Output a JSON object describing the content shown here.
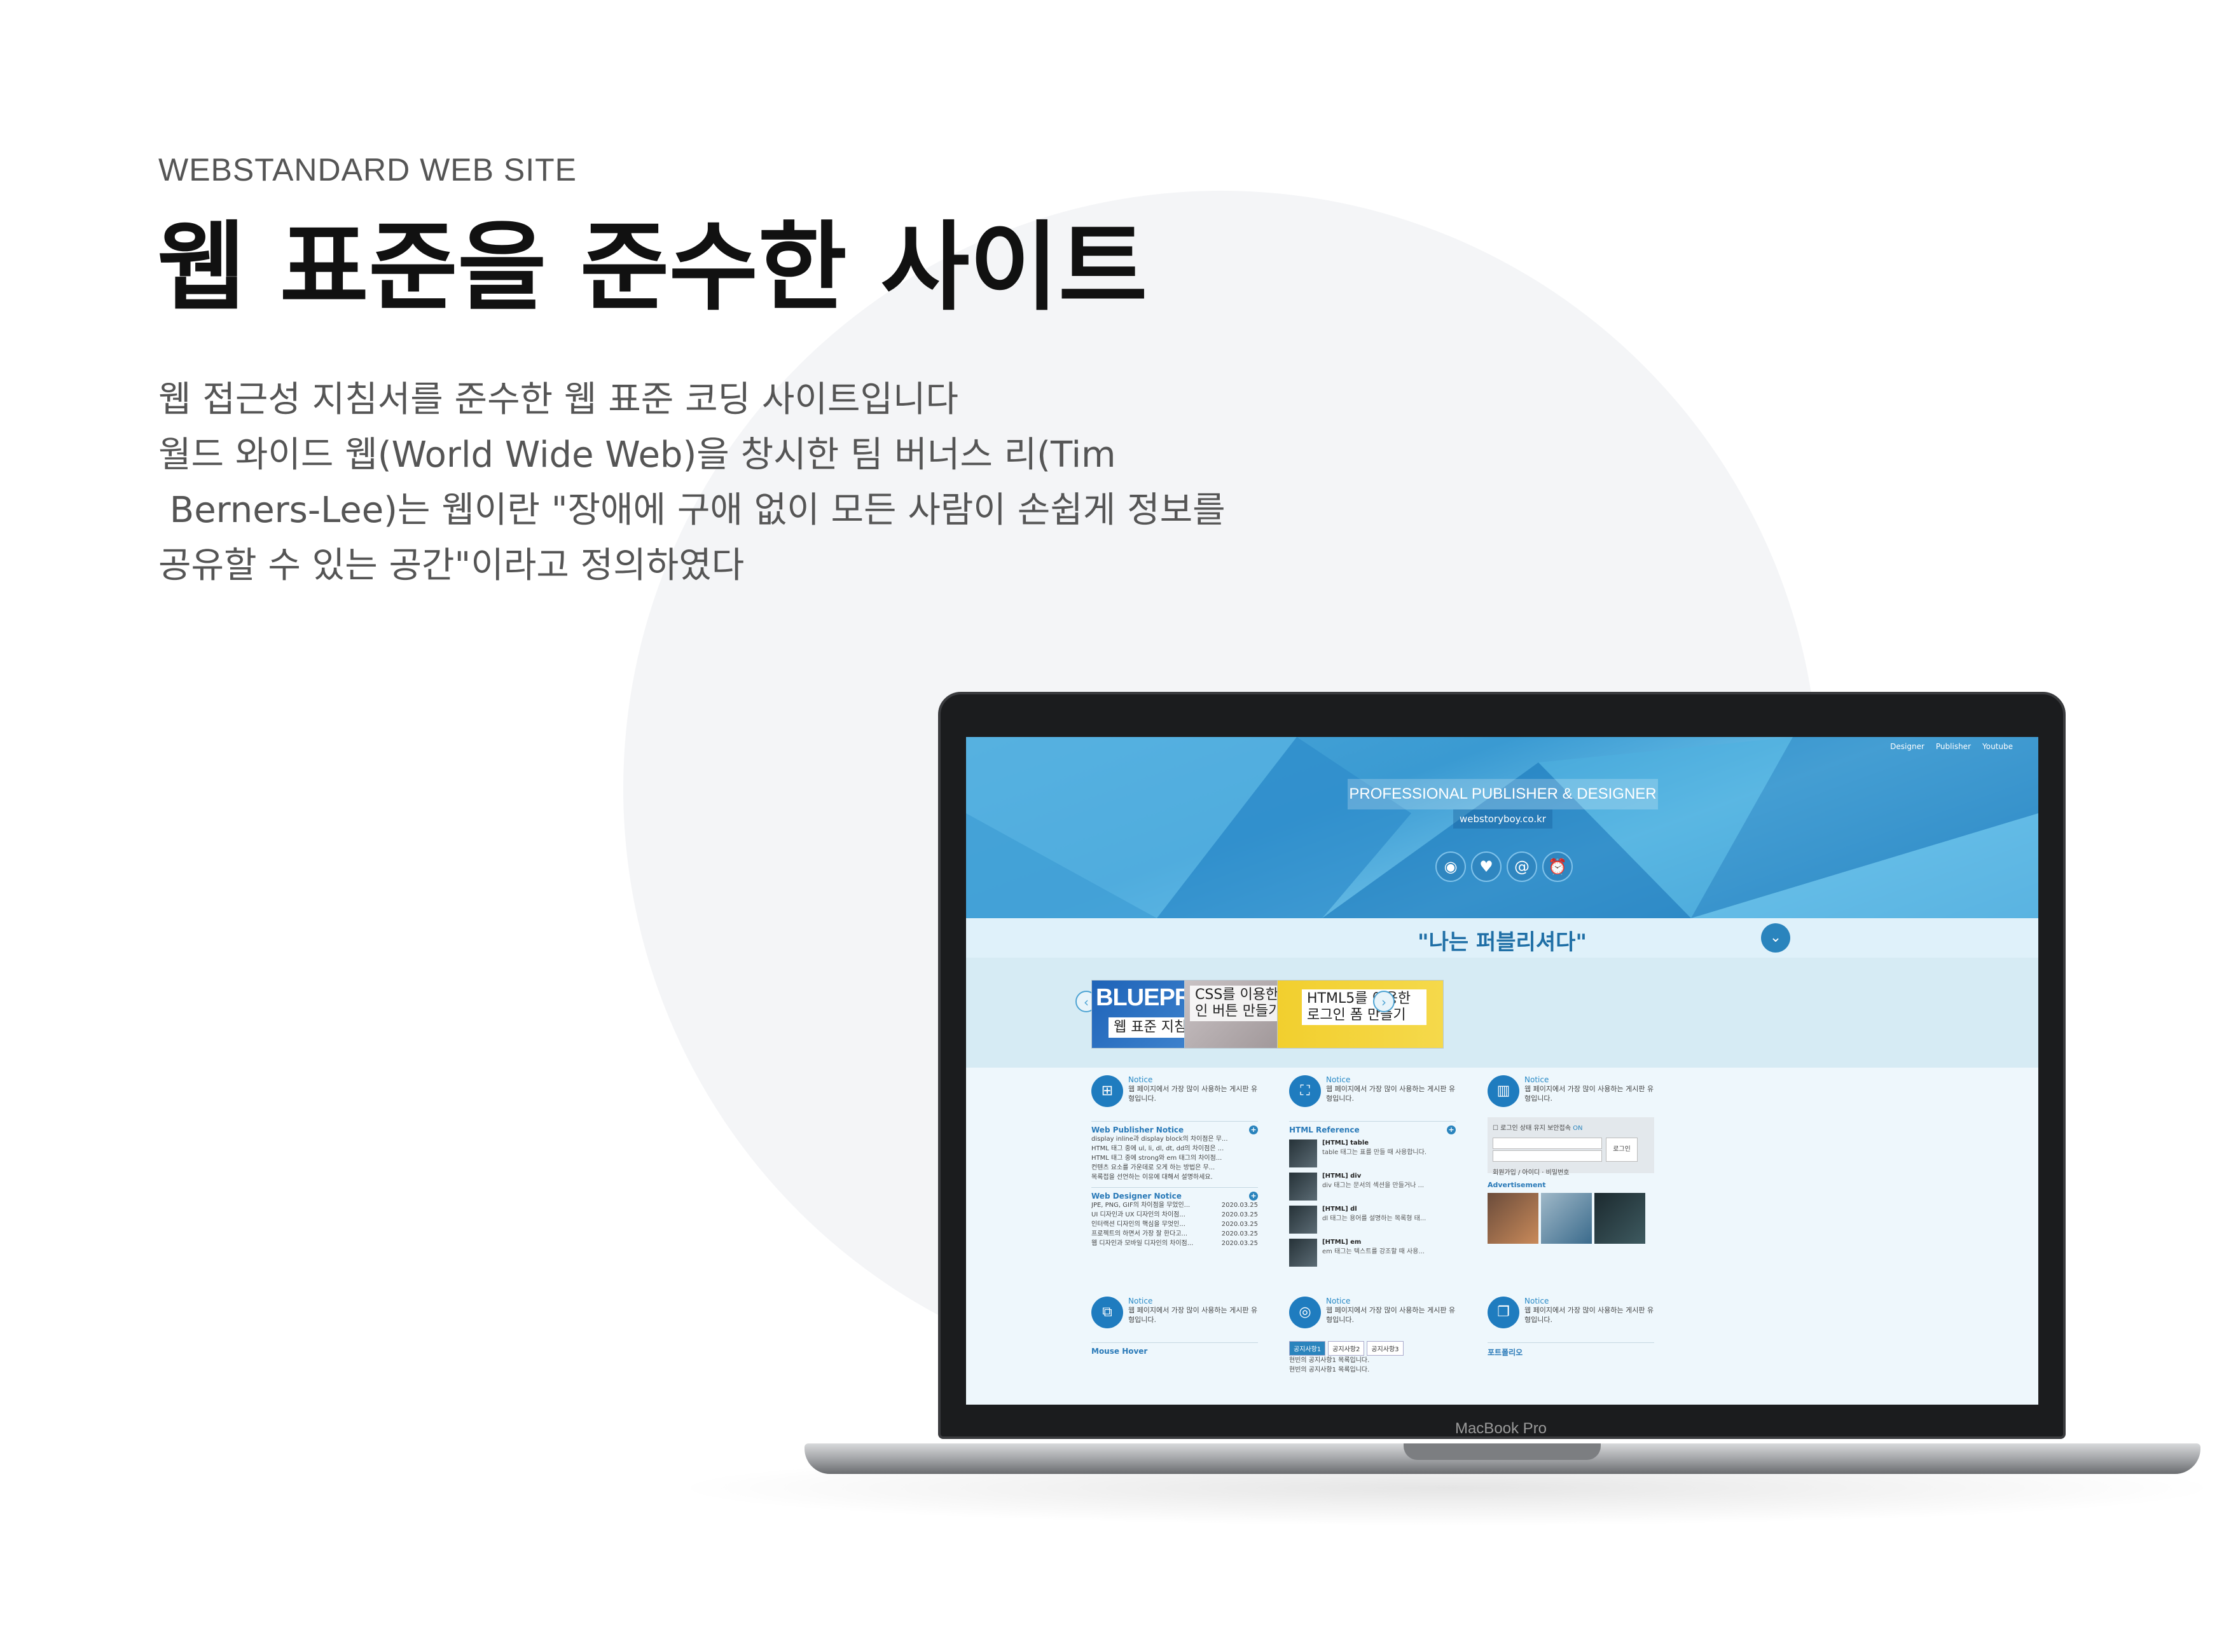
{
  "promo": {
    "eyebrow": "WEBSTANDARD WEB SITE",
    "title": "웹 표준을 준수한 사이트",
    "description_lines": [
      "웹 접근성 지침서를 준수한 웹 표준 코딩 사이트입니다",
      "월드 와이드 웹(World Wide Web)을 창시한 팀 버너스 리(Tim",
      " Berners-Lee)는 웹이란 \"장애에 구애 없이 모든 사람이 손쉽게 정보를",
      "공유할 수 있는 공간\"이라고 정의하였다"
    ]
  },
  "device": {
    "label": "MacBook Pro"
  },
  "site": {
    "nav": [
      "Designer",
      "Publisher",
      "Youtube"
    ],
    "hero_title": "PROFESSIONAL PUBLISHER & DESIGNER",
    "hero_url": "webstoryboy.co.kr",
    "hero_icons": [
      "target-icon",
      "heart-icon",
      "at-icon",
      "alarm-icon"
    ],
    "quote": "\"나는 퍼블리셔다\"",
    "slides": [
      {
        "big": "BLUEPRINTS",
        "caption": "웹 표준 지침서 보기"
      },
      {
        "big": "",
        "caption": "CSS를 이용한 입체적인 버튼 만들기"
      },
      {
        "big": "",
        "caption": "HTML5를 이용한 로그인 폼 만들기"
      }
    ],
    "notice_label": "Notice",
    "notice_desc": "웹 페이지에서 가장 많이 사용하는 게시판 유형입니다.",
    "publisher_notice": {
      "title": "Web Publisher Notice",
      "items": [
        "display inline과 display block의 차이점은 무...",
        "HTML 태그 중에 ul, li, dl, dt, dd의 차이점은 ...",
        "HTML 태그 중에 strong와 em 태그의 차이점...",
        "컨텐츠 요소를 가운데로 오게 하는 방법은 무...",
        "목록접을 선언하는 이유에 대해서 설명하세요."
      ]
    },
    "designer_notice": {
      "title": "Web Designer Notice",
      "items": [
        {
          "text": "JPE, PNG, GIF의 차이점을 무었인...",
          "date": "2020.03.25"
        },
        {
          "text": "UI 디자인과 UX 디자인의 차이점...",
          "date": "2020.03.25"
        },
        {
          "text": "인터랙션 디자인의 핵심을 무엇인...",
          "date": "2020.03.25"
        },
        {
          "text": "프로젝트의 하면서 가장 잘 한다고...",
          "date": "2020.03.25"
        },
        {
          "text": "웹 디자인과 모바일 디자인의 차이점...",
          "date": "2020.03.25"
        }
      ]
    },
    "html_reference": {
      "title": "HTML Reference",
      "items": [
        {
          "t": "[HTML] table",
          "d": "table 태그는 표를 만들 때 사용합니다."
        },
        {
          "t": "[HTML] div",
          "d": "div 태그는 문서의 섹션을 만들거나 ..."
        },
        {
          "t": "[HTML] dl",
          "d": "dl 태그는 용어를 설명하는 목록형 태..."
        },
        {
          "t": "[HTML] em",
          "d": "em 태그는 텍스트를 강조할 때 사용..."
        }
      ]
    },
    "login": {
      "keep": "로그인 상태 유지",
      "secure": "보안접속",
      "secure_state": "ON",
      "button": "로그인",
      "links": "회원가입 / 아이디 · 비밀번호"
    },
    "ad_title": "Advertisement",
    "mouse_hover": "Mouse Hover",
    "notice_tabs": [
      "공지사항1",
      "공지사항2",
      "공지사항3"
    ],
    "notice_tab_items": [
      "현빈의 공지사항1 목록입니다.",
      "현빈의 공지사항1 목록입니다."
    ],
    "portfolio": "포트폴리오"
  },
  "colors": {
    "accent": "#2a84bd",
    "hero": "#3a9ad2",
    "bg_circle": "#f4f5f7"
  }
}
